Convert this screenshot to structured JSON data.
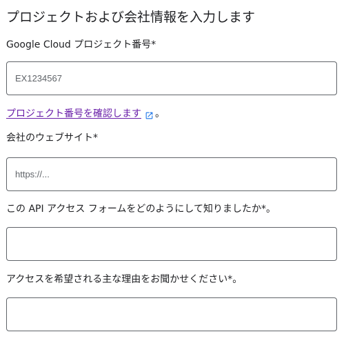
{
  "form": {
    "heading": "プロジェクトおよび会社情報を入力します",
    "project_number": {
      "label": "Google Cloud プロジェクト番号*",
      "placeholder": "EX1234567"
    },
    "confirm_link": {
      "label": "プロジェクト番号を確認します",
      "trailing": "。",
      "icon": "external-link-icon"
    },
    "website": {
      "label": "会社のウェブサイト*",
      "placeholder": "https://..."
    },
    "how_did_you_hear": {
      "label": "この API アクセス フォームをどのようにして知りましたか*。",
      "value": ""
    },
    "reason": {
      "label": "アクセスを希望される主な理由をお聞かせください*。",
      "value": ""
    }
  },
  "colors": {
    "link": "#681da8",
    "external_icon": "#1a73e8",
    "border": "#5f6368"
  }
}
